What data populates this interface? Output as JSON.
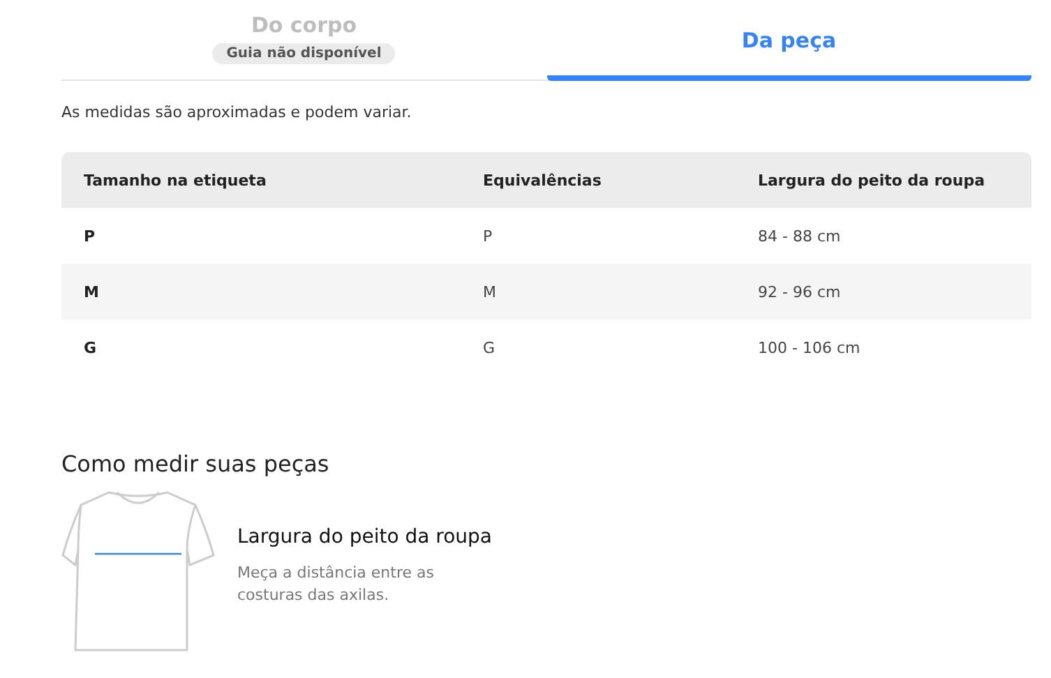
{
  "tabs": [
    {
      "label": "Do corpo",
      "badge": "Guia não disponível",
      "selected": false,
      "disabled": true
    },
    {
      "label": "Da peça",
      "selected": true,
      "disabled": false
    }
  ],
  "note": "As medidas são aproximadas e podem variar.",
  "table": {
    "columns": [
      "Tamanho na etiqueta",
      "Equivalências",
      "Largura do peito da roupa"
    ],
    "rows": [
      [
        "P",
        "P",
        "84 - 88 cm"
      ],
      [
        "M",
        "M",
        "92 - 96 cm"
      ],
      [
        "G",
        "G",
        "100 - 106 cm"
      ]
    ]
  },
  "how_to": {
    "title": "Como medir suas peças",
    "measure_title": "Largura do peito da roupa",
    "measure_text": "Meça a distância entre as costuras das axilas."
  }
}
